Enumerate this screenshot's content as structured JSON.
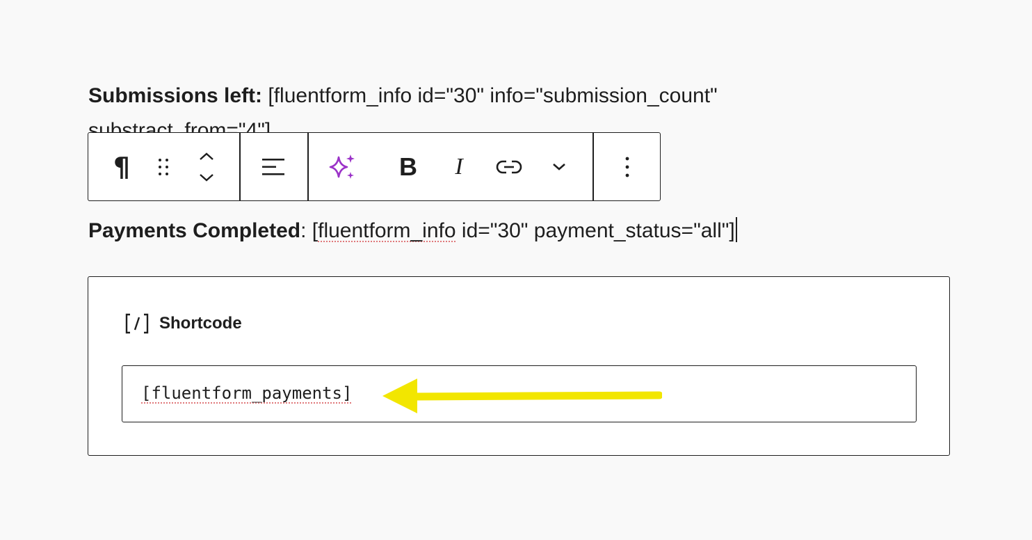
{
  "paragraph1": {
    "label": "Submissions left:",
    "text": " [fluentform_info id=\"30\" info=\"submission_count\"",
    "line2": "substract_from=\"4\"]"
  },
  "paragraph2": {
    "label": "Payments Completed",
    "colon": ":",
    "text_before": " [",
    "spell_word": "fluentform_info",
    "text_after": " id=\"30\" payment_status=\"all\"]"
  },
  "toolbar": {
    "items": [
      {
        "icon": "paragraph-icon",
        "glyph": "¶"
      },
      {
        "icon": "drag-handle-icon"
      },
      {
        "icon": "move-up-down-icon"
      },
      {
        "icon": "align-left-icon"
      },
      {
        "icon": "ai-sparkle-icon"
      },
      {
        "icon": "bold-icon",
        "glyph": "B"
      },
      {
        "icon": "italic-icon",
        "glyph": "I"
      },
      {
        "icon": "link-icon"
      },
      {
        "icon": "more-rich-text-chevron-icon"
      },
      {
        "icon": "options-kebab-icon"
      }
    ],
    "colors": {
      "sparkle": "#9b32c8",
      "border": "#1e1e1e"
    }
  },
  "shortcode": {
    "icon": "shortcode-icon",
    "label": "Shortcode",
    "value": "[fluentform_payments]"
  },
  "annotation": {
    "icon": "yellow-arrow-icon",
    "color": "#f2e600"
  }
}
